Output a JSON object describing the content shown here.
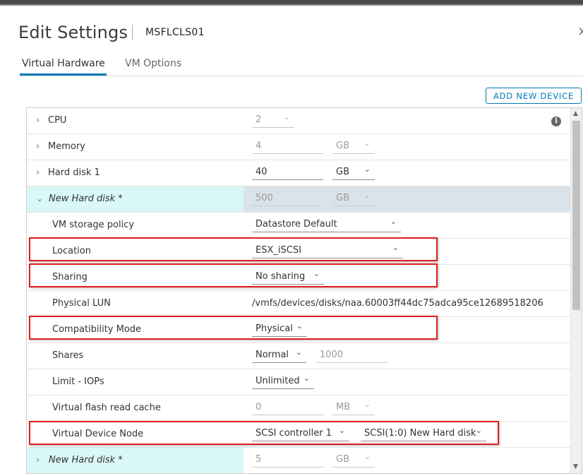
{
  "dialog": {
    "title": "Edit Settings",
    "vm_name": "MSFLCLS01",
    "close_glyph": "×"
  },
  "tabs": [
    {
      "label": "Virtual Hardware",
      "active": true
    },
    {
      "label": "VM Options",
      "active": false
    }
  ],
  "add_button": "ADD NEW DEVICE",
  "rows": {
    "cpu": {
      "label": "CPU",
      "value": "2"
    },
    "memory": {
      "label": "Memory",
      "value": "4",
      "unit": "GB"
    },
    "hard_disk_1": {
      "label": "Hard disk 1",
      "value": "40",
      "unit": "GB"
    },
    "new_hard_disk": {
      "label": "New Hard disk *",
      "value": "500",
      "unit": "GB"
    },
    "vm_storage_policy": {
      "label": "VM storage policy",
      "value": "Datastore Default"
    },
    "location": {
      "label": "Location",
      "value": "ESX_iSCSI"
    },
    "sharing": {
      "label": "Sharing",
      "value": "No sharing"
    },
    "physical_lun": {
      "label": "Physical LUN",
      "value": "/vmfs/devices/disks/naa.60003ff44dc75adca95ce12689518206"
    },
    "compatibility_mode": {
      "label": "Compatibility Mode",
      "value": "Physical"
    },
    "shares": {
      "label": "Shares",
      "value": "Normal",
      "amount": "1000"
    },
    "limit_iops": {
      "label": "Limit - IOPs",
      "value": "Unlimited"
    },
    "flash_cache": {
      "label": "Virtual flash read cache",
      "value": "0",
      "unit": "MB"
    },
    "device_node": {
      "label": "Virtual Device Node",
      "controller": "SCSI controller 1",
      "node": "SCSI(1:0) New Hard disk"
    },
    "new_hard_disk_2": {
      "label": "New Hard disk *",
      "value": "5",
      "unit": "GB"
    }
  },
  "icons": {
    "chevron_right": "›",
    "chevron_down": "⌄",
    "caret": "⌄",
    "info": "i"
  },
  "colors": {
    "accent": "#0079b8",
    "highlight": "#e01f1f",
    "cyan_row": "#d9f7f7",
    "selected_row": "#dbe3ea"
  }
}
